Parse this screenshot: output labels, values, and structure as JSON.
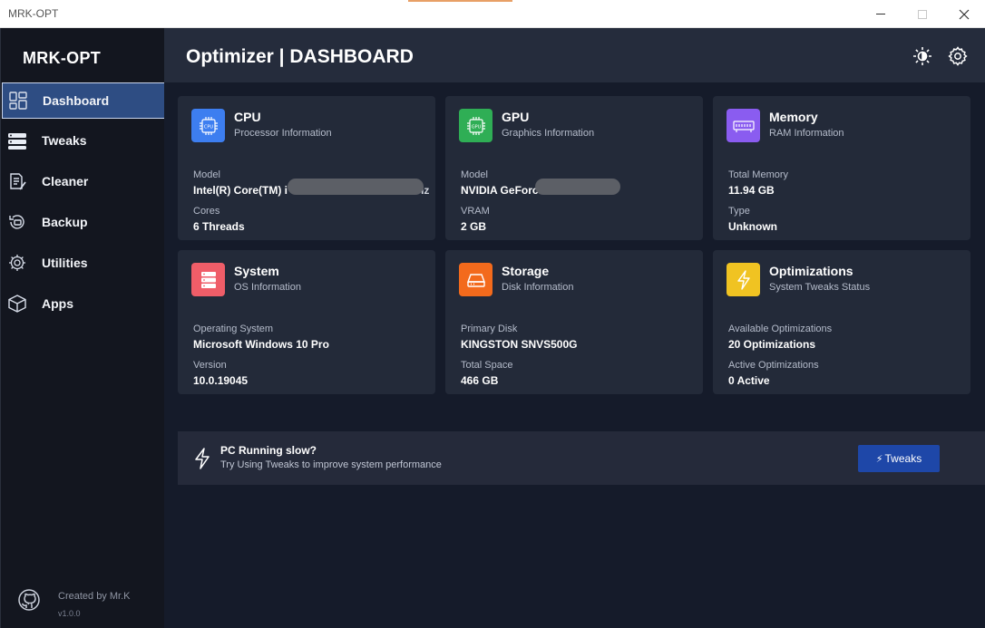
{
  "window": {
    "title": "MRK-OPT"
  },
  "sidebar": {
    "brand": "MRK-OPT",
    "items": [
      {
        "label": "Dashboard",
        "icon": "dashboard-icon",
        "active": true
      },
      {
        "label": "Tweaks",
        "icon": "server-icon"
      },
      {
        "label": "Cleaner",
        "icon": "cleaner-icon"
      },
      {
        "label": "Backup",
        "icon": "backup-icon"
      },
      {
        "label": "Utilities",
        "icon": "gear-icon"
      },
      {
        "label": "Apps",
        "icon": "package-icon"
      }
    ],
    "footer": {
      "credit": "Created by Mr.K",
      "version": "v1.0.0",
      "icon": "github-icon"
    }
  },
  "header": {
    "title": "Optimizer | DASHBOARD",
    "icons": [
      "theme-toggle-icon",
      "settings-icon"
    ]
  },
  "cards": {
    "cpu": {
      "title": "CPU",
      "subtitle": "Processor Information",
      "color": "#3d7ef0",
      "f1_label": "Model",
      "f1_value": "Intel(R) Core(TM) i",
      "f1_tail": "2.30GHz",
      "f2_label": "Cores",
      "f2_value": "6 Threads"
    },
    "gpu": {
      "title": "GPU",
      "subtitle": "Graphics Information",
      "color": "#2fae55",
      "f1_label": "Model",
      "f1_value": "NVIDIA GeForce",
      "f2_label": "VRAM",
      "f2_value": "2 GB"
    },
    "memory": {
      "title": "Memory",
      "subtitle": "RAM Information",
      "color": "#8a5cf0",
      "f1_label": "Total Memory",
      "f1_value": "11.94 GB",
      "f2_label": "Type",
      "f2_value": "Unknown"
    },
    "system": {
      "title": "System",
      "subtitle": "OS Information",
      "color": "#ef5d68",
      "f1_label": "Operating System",
      "f1_value": "Microsoft Windows 10 Pro",
      "f2_label": "Version",
      "f2_value": "10.0.19045"
    },
    "storage": {
      "title": "Storage",
      "subtitle": "Disk Information",
      "color": "#f36a1c",
      "f1_label": "Primary Disk",
      "f1_value": "KINGSTON SNVS500G",
      "f2_label": "Total Space",
      "f2_value": "466 GB"
    },
    "optimizations": {
      "title": "Optimizations",
      "subtitle": "System Tweaks Status",
      "color": "#f0c322",
      "f1_label": "Available Optimizations",
      "f1_value": "20 Optimizations",
      "f2_label": "Active Optimizations",
      "f2_value": "0 Active"
    }
  },
  "banner": {
    "title": "PC Running slow?",
    "subtitle": "Try Using Tweaks to improve system performance",
    "button_icon": "⚡",
    "button_label": "Tweaks"
  }
}
